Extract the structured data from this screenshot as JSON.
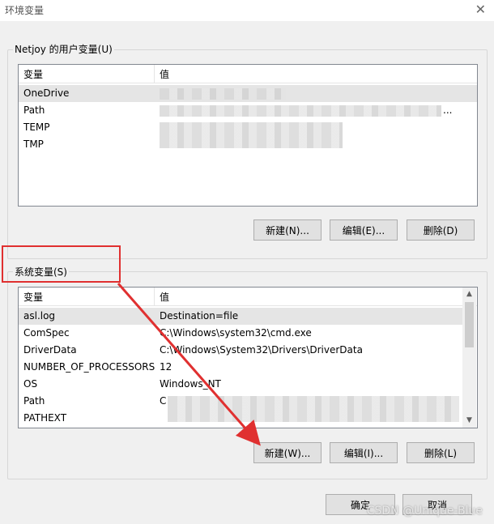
{
  "window": {
    "title": "环境变量"
  },
  "user_vars": {
    "group_label": "Netjoy 的用户变量(U)",
    "col_variable": "变量",
    "col_value": "值",
    "rows": [
      {
        "name": "OneDrive",
        "value": ""
      },
      {
        "name": "Path",
        "value": "..."
      },
      {
        "name": "TEMP",
        "value": ""
      },
      {
        "name": "TMP",
        "value": ""
      }
    ],
    "buttons": {
      "new": "新建(N)...",
      "edit": "编辑(E)...",
      "delete": "删除(D)"
    }
  },
  "system_vars": {
    "group_label": "系统变量(S)",
    "col_variable": "变量",
    "col_value": "值",
    "rows": [
      {
        "name": "asl.log",
        "value": "Destination=file"
      },
      {
        "name": "ComSpec",
        "value": "C:\\Windows\\system32\\cmd.exe"
      },
      {
        "name": "DriverData",
        "value": "C:\\Windows\\System32\\Drivers\\DriverData"
      },
      {
        "name": "NUMBER_OF_PROCESSORS",
        "value": "12"
      },
      {
        "name": "OS",
        "value": "Windows_NT"
      },
      {
        "name": "Path",
        "value": "C"
      },
      {
        "name": "PATHEXT",
        "value": ""
      }
    ],
    "buttons": {
      "new": "新建(W)...",
      "edit": "编辑(I)...",
      "delete": "删除(L)"
    }
  },
  "footer": {
    "ok": "确定",
    "cancel": "取消"
  },
  "watermark": "CSDN @Unique-Blue",
  "colors": {
    "highlight_box": "#e03030",
    "annotation_arrow": "#e03030"
  }
}
